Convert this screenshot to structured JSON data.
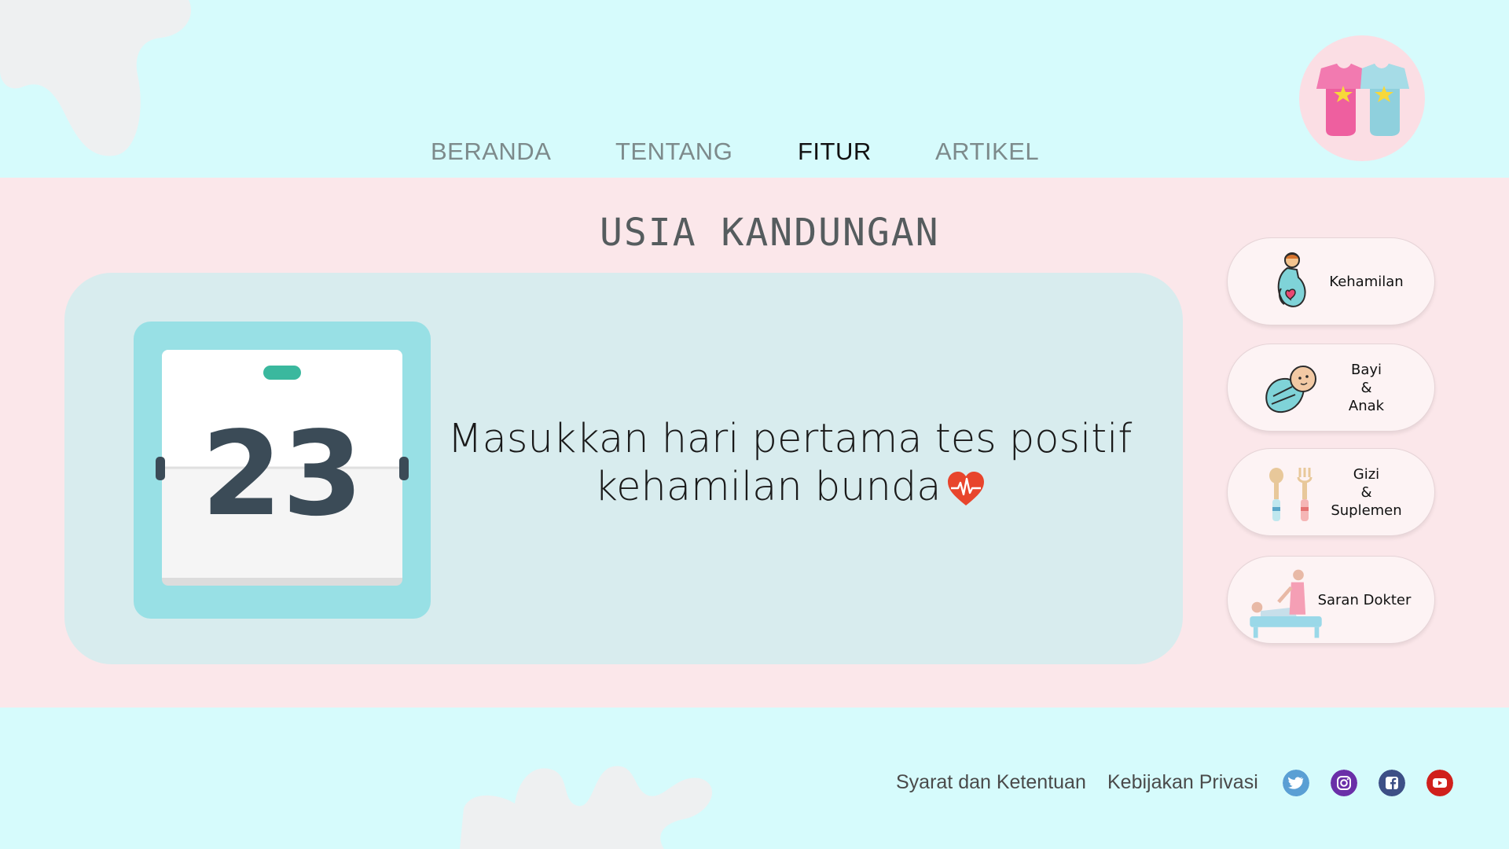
{
  "nav": {
    "items": [
      {
        "label": "BERANDA"
      },
      {
        "label": "TENTANG"
      },
      {
        "label": "FITUR"
      },
      {
        "label": "ARTIKEL"
      }
    ],
    "active": "FITUR"
  },
  "logo": {
    "icon": "baby-onesies-icon"
  },
  "section": {
    "title": "USIA KANDUNGAN"
  },
  "calendar": {
    "day": "23",
    "icon": "calendar-icon"
  },
  "message": {
    "line1": "Masukkan hari pertama tes positif",
    "line2": "kehamilan bunda",
    "icon": "heartbeat-heart-icon"
  },
  "side_menu": [
    {
      "label": "Kehamilan",
      "icon": "pregnant-mother-icon"
    },
    {
      "label": "Bayi\n&\nAnak",
      "icon": "swaddled-baby-icon"
    },
    {
      "label": "Gizi\n&\nSuplemen",
      "icon": "feeding-spoons-icon"
    },
    {
      "label": "Saran Dokter",
      "icon": "doctor-patient-icon"
    }
  ],
  "footer": {
    "links": [
      {
        "label": "Syarat dan Ketentuan"
      },
      {
        "label": "Kebijakan Privasi"
      }
    ],
    "social": [
      {
        "icon": "twitter-icon",
        "color": "#5a9fd4"
      },
      {
        "icon": "instagram-icon",
        "color": "#6a2fa8"
      },
      {
        "icon": "facebook-icon",
        "color": "#3d4f86"
      },
      {
        "icon": "youtube-icon",
        "color": "#d0201c"
      }
    ]
  },
  "colors": {
    "background": "#d6fbfc",
    "band": "#fbe7ea",
    "card": "#d8ecee",
    "calendar_frame": "#98e0e5",
    "text_dark": "#3b4b57"
  }
}
